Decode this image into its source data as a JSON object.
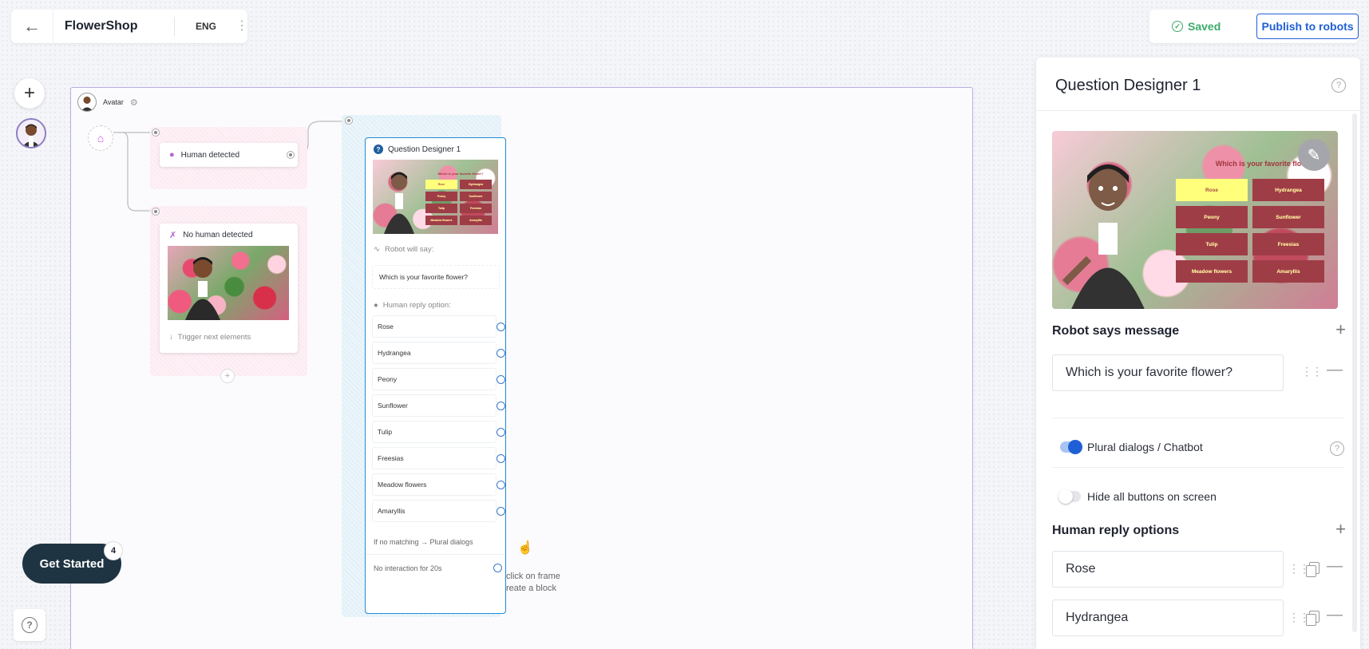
{
  "header": {
    "app_title": "FlowerShop",
    "language": "ENG",
    "saved_label": "Saved",
    "publish_label": "Publish to robots"
  },
  "canvas": {
    "avatar_label": "Avatar",
    "nodes": {
      "human_detected": "Human detected",
      "no_human_detected": "No human detected",
      "trigger_next": "Trigger next elements"
    },
    "question_designer": {
      "title": "Question Designer 1",
      "preview_question": "Which is your favorite flower?",
      "robot_will_say_label": "Robot will say:",
      "robot_says": "Which is your favorite flower?",
      "human_reply_label": "Human reply option:",
      "options": [
        "Rose",
        "Hydrangea",
        "Peony",
        "Sunflower",
        "Tulip",
        "Freesias",
        "Meadow flowers",
        "Amaryllis"
      ],
      "no_matching": "If no matching → Plural dialogs",
      "no_interaction": "No interaction for 20s"
    },
    "hint_text_line1": "click on frame",
    "hint_text_line2": "reate a block"
  },
  "panel": {
    "title": "Question Designer 1",
    "preview": {
      "question": "Which is your favorite flower?",
      "buttons": [
        "Rose",
        "Hydrangea",
        "Peony",
        "Sunflower",
        "Tulip",
        "Freesias",
        "Meadow flowers",
        "Amaryllis"
      ],
      "selected": "Rose"
    },
    "robot_says_heading": "Robot says message",
    "robot_says_value": "Which is your favorite flower?",
    "plural_dialogs_label": "Plural dialogs / Chatbot",
    "plural_dialogs_on": true,
    "hide_buttons_label": "Hide all buttons on screen",
    "hide_buttons_on": false,
    "human_reply_heading": "Human reply options",
    "reply_options": [
      "Rose",
      "Hydrangea"
    ]
  },
  "get_started": {
    "label": "Get Started",
    "badge": "4"
  },
  "colors": {
    "accent": "#1f5fd6",
    "saved_green": "#3cab6c",
    "node_purple": "#b55fd6",
    "button_red": "#b22736",
    "button_yellow": "#f4ea1c"
  }
}
